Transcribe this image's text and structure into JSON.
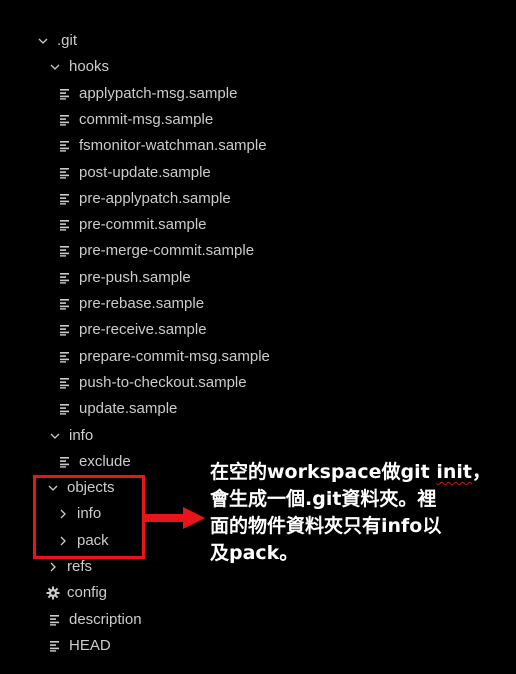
{
  "colors": {
    "background": "#000000",
    "tree_text": "#cccccc",
    "highlight": "#e8141c",
    "annotation_text": "#ffffff"
  },
  "tree": [
    {
      "label": ".git",
      "type": "folder",
      "expanded": true,
      "icon": "chevron-down-icon"
    },
    {
      "label": "hooks",
      "type": "folder",
      "expanded": true,
      "icon": "chevron-down-icon"
    },
    {
      "label": "applypatch-msg.sample",
      "type": "file",
      "icon": "file-lines-icon"
    },
    {
      "label": "commit-msg.sample",
      "type": "file",
      "icon": "file-lines-icon"
    },
    {
      "label": "fsmonitor-watchman.sample",
      "type": "file",
      "icon": "file-lines-icon"
    },
    {
      "label": "post-update.sample",
      "type": "file",
      "icon": "file-lines-icon"
    },
    {
      "label": "pre-applypatch.sample",
      "type": "file",
      "icon": "file-lines-icon"
    },
    {
      "label": "pre-commit.sample",
      "type": "file",
      "icon": "file-lines-icon"
    },
    {
      "label": "pre-merge-commit.sample",
      "type": "file",
      "icon": "file-lines-icon"
    },
    {
      "label": "pre-push.sample",
      "type": "file",
      "icon": "file-lines-icon"
    },
    {
      "label": "pre-rebase.sample",
      "type": "file",
      "icon": "file-lines-icon"
    },
    {
      "label": "pre-receive.sample",
      "type": "file",
      "icon": "file-lines-icon"
    },
    {
      "label": "prepare-commit-msg.sample",
      "type": "file",
      "icon": "file-lines-icon"
    },
    {
      "label": "push-to-checkout.sample",
      "type": "file",
      "icon": "file-lines-icon"
    },
    {
      "label": "update.sample",
      "type": "file",
      "icon": "file-lines-icon"
    },
    {
      "label": "info",
      "type": "folder",
      "expanded": true,
      "icon": "chevron-down-icon"
    },
    {
      "label": "exclude",
      "type": "file",
      "icon": "file-lines-icon"
    },
    {
      "label": "objects",
      "type": "folder",
      "expanded": true,
      "icon": "chevron-down-icon"
    },
    {
      "label": "info",
      "type": "folder",
      "expanded": false,
      "icon": "chevron-right-icon"
    },
    {
      "label": "pack",
      "type": "folder",
      "expanded": false,
      "icon": "chevron-right-icon"
    },
    {
      "label": "refs",
      "type": "folder",
      "expanded": false,
      "icon": "chevron-right-icon"
    },
    {
      "label": "config",
      "type": "file",
      "icon": "gear-icon"
    },
    {
      "label": "description",
      "type": "file",
      "icon": "file-lines-icon"
    },
    {
      "label": "HEAD",
      "type": "file",
      "icon": "file-lines-icon"
    }
  ],
  "annotation": {
    "line1_prefix": "在空的workspace做git ",
    "line1_marked": "init",
    "line1_suffix": "，",
    "line2": "會生成一個.git資料夾。裡",
    "line3": "面的物件資料夾只有info以",
    "line4": "及pack。"
  }
}
